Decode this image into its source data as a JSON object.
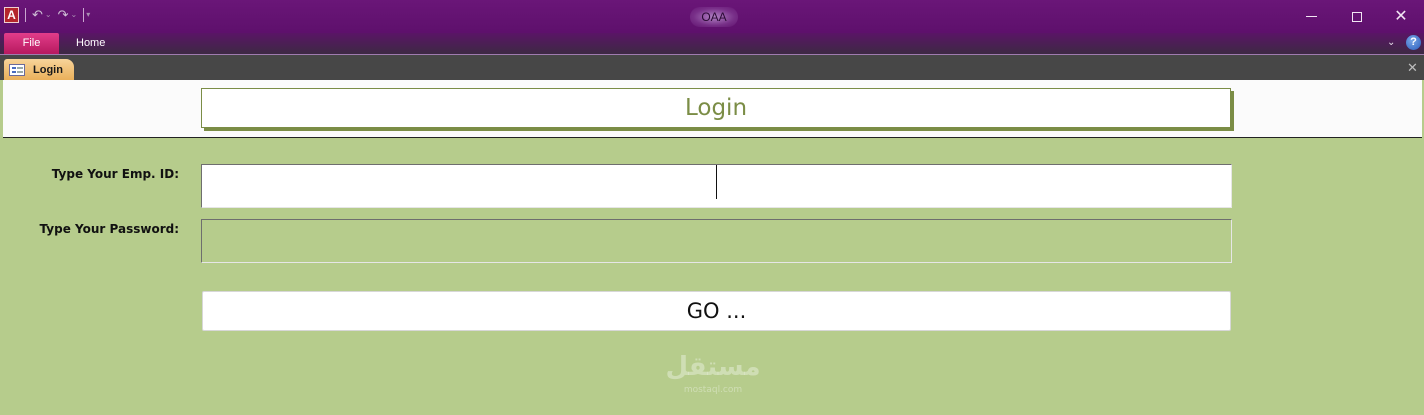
{
  "window": {
    "title": "OAA",
    "app_logo_letter": "A"
  },
  "qat": {
    "undo_icon": "undo-icon",
    "redo_icon": "redo-icon"
  },
  "ribbon": {
    "file_label": "File",
    "home_label": "Home"
  },
  "doc_tab": {
    "label": "Login"
  },
  "form": {
    "title": "Login",
    "emp_id_label": "Type Your Emp. ID:",
    "emp_id_value": "",
    "password_label": "Type Your Password:",
    "password_value": "",
    "go_label": "GO ..."
  },
  "watermark": {
    "text": "مستقل",
    "subtext": "mostaql.com"
  },
  "colors": {
    "title_bar": "#6a1678",
    "file_tab": "#e23d8a",
    "doc_tab": "#eab05a",
    "form_body": "#b6cc8c",
    "accent_olive": "#7b8d46"
  }
}
